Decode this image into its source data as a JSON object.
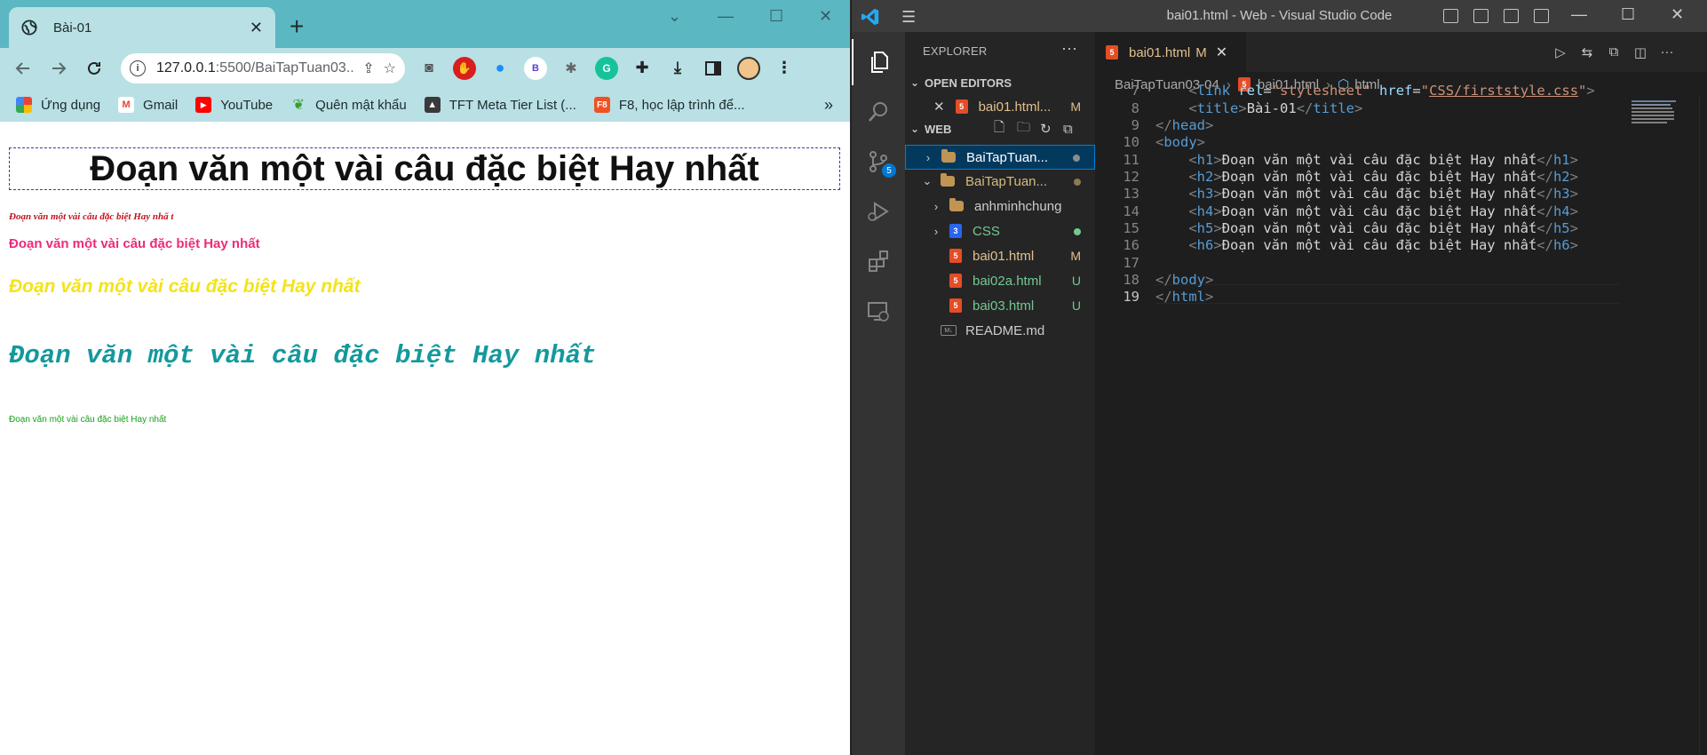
{
  "browser": {
    "tab_title": "Bài-01",
    "url_host": "127.0.0.1",
    "url_path": ":5500/BaiTapTuan03...",
    "bookmarks": [
      {
        "label": "Ứng dụng",
        "icon": "apps-grid-icon"
      },
      {
        "label": "Gmail",
        "icon": "gmail-icon"
      },
      {
        "label": "YouTube",
        "icon": "youtube-icon"
      },
      {
        "label": "Quên mật khẩu",
        "icon": "leaf-icon"
      },
      {
        "label": "TFT Meta Tier List (...",
        "icon": "tft-icon"
      },
      {
        "label": "F8, học lập trình để...",
        "icon": "f8-icon"
      }
    ],
    "more_bookmarks": "»",
    "extension_b_label": "B"
  },
  "page": {
    "h1": "Đoạn văn một vài câu đặc biệt Hay nhất",
    "h2": "Đoạn văn một vài câu đặc biệt Hay nhấ t",
    "h3": "Đoạn văn một vài câu đặc biệt Hay nhất",
    "h4": "Đoạn văn một vài câu đặc biệt Hay nhất",
    "h5": "Đoạn văn một vài câu đặc biệt Hay nhất",
    "h6": "Đoạn văn một vài câu đặc biệt Hay nhất"
  },
  "vscode": {
    "window_title": "bai01.html - Web - Visual Studio Code",
    "explorer_title": "EXPLORER",
    "open_editors_label": "OPEN EDITORS",
    "open_editor_file": "bai01.html...",
    "open_editor_status": "M",
    "workspace_label": "WEB",
    "scm_badge": "5",
    "tree": [
      {
        "label": "BaiTapTuan...",
        "type": "folder",
        "status_dot": true
      },
      {
        "label": "BaiTapTuan...",
        "type": "folder",
        "status_dot": true
      },
      {
        "label": "anhminhchung",
        "type": "folder",
        "status": ""
      },
      {
        "label": "CSS",
        "type": "css",
        "status_dot": true
      },
      {
        "label": "bai01.html",
        "type": "html",
        "status": "M"
      },
      {
        "label": "bai02a.html",
        "type": "html",
        "status": "U"
      },
      {
        "label": "bai03.html",
        "type": "html",
        "status": "U"
      },
      {
        "label": "README.md",
        "type": "md",
        "status": ""
      }
    ],
    "editor_tab": {
      "label": "bai01.html",
      "status": "M"
    },
    "breadcrumb": [
      "BaiTapTuan03-04",
      "bai01.html",
      "html"
    ],
    "line_numbers": [
      "7",
      "8",
      "9",
      "10",
      "11",
      "12",
      "13",
      "14",
      "15",
      "16",
      "17",
      "18",
      "19"
    ],
    "code": {
      "l7_rel": "stylesheet",
      "l7_href": "CSS/firststyle.css",
      "l8_title": "Bài-01",
      "heading_text": "Đoạn văn một vài câu đặc biệt Hay nhất"
    }
  },
  "colors": {
    "chrome_frame": "#5bb7c2",
    "chrome_toolbar": "#b9e0e4",
    "h2_color": "#c1121f",
    "h3_color": "#ee2a7b",
    "h4_color": "#f4e319",
    "h5_color": "#13999c",
    "h6_color": "#18a01a",
    "vscode_bg": "#1e1e1e"
  }
}
